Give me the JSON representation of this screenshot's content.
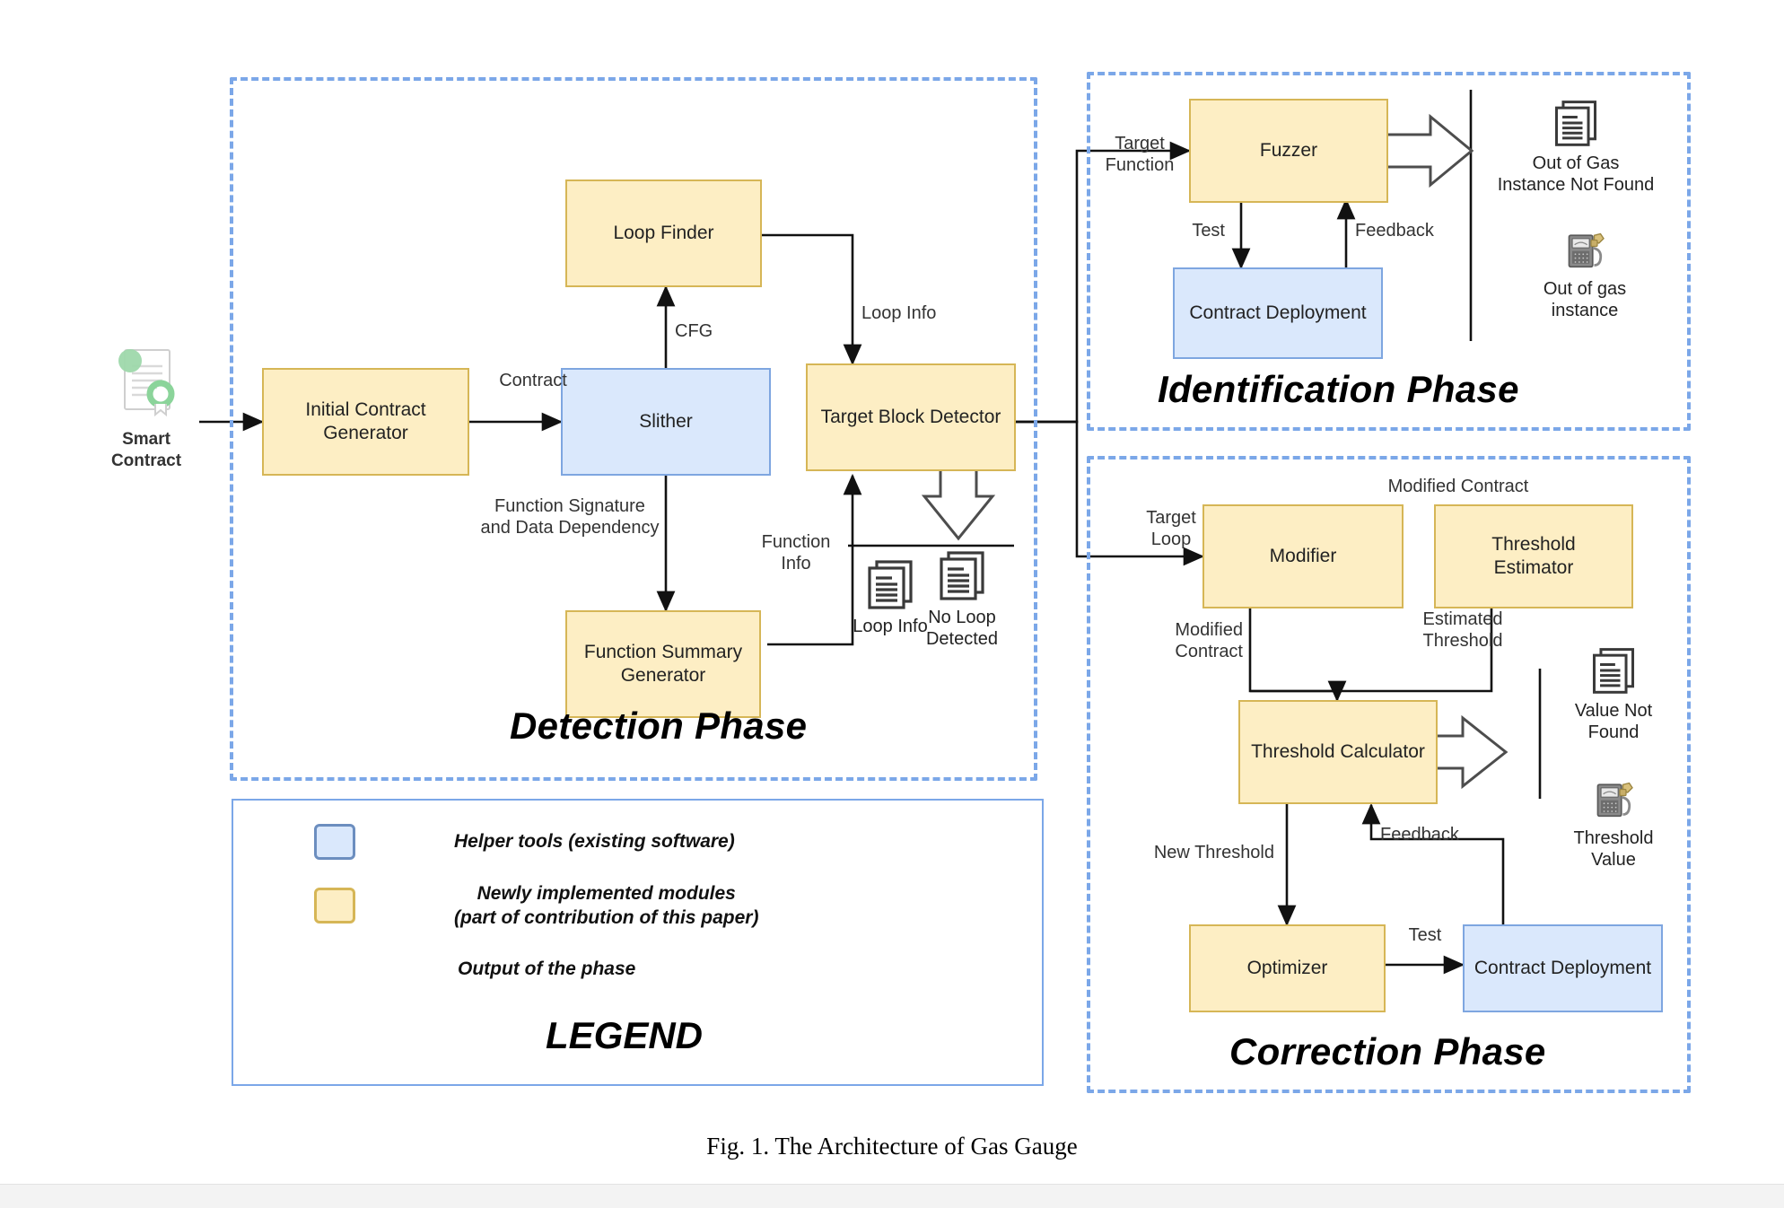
{
  "figure": {
    "caption": "Fig. 1.  The Architecture of Gas Gauge"
  },
  "colors": {
    "module_fill": "#fdeec4",
    "module_stroke": "#d6b656",
    "helper_fill": "#dae8fc",
    "helper_stroke": "#7ea6e0",
    "phase_border": "#7ba7e8",
    "seal": "#8bd49a"
  },
  "input": {
    "label": "Smart\nContract",
    "icon": "contract-document-icon"
  },
  "phases": [
    {
      "id": "detection",
      "title": "Detection Phase"
    },
    {
      "id": "identification",
      "title": "Identification Phase"
    },
    {
      "id": "correction",
      "title": "Correction Phase"
    }
  ],
  "detection": {
    "title": "Detection Phase",
    "nodes": [
      {
        "id": "initial-contract-generator",
        "label": "Initial Contract\nGenerator",
        "kind": "module"
      },
      {
        "id": "slither",
        "label": "Slither",
        "kind": "helper"
      },
      {
        "id": "loop-finder",
        "label": "Loop Finder",
        "kind": "module"
      },
      {
        "id": "target-block-detector",
        "label": "Target Block Detector",
        "kind": "module"
      },
      {
        "id": "function-summary-generator",
        "label": "Function Summary\nGenerator",
        "kind": "module"
      }
    ],
    "edge_labels": [
      {
        "id": "contract",
        "text": "Contract"
      },
      {
        "id": "cfg",
        "text": "CFG"
      },
      {
        "id": "loop-info",
        "text": "Loop Info"
      },
      {
        "id": "function-signature",
        "text": "Function Signature\nand Data Dependency"
      },
      {
        "id": "function-info",
        "text": "Function\nInfo"
      }
    ],
    "outputs": [
      {
        "id": "loop-info-output",
        "label": "Loop Info",
        "icon": "documents-icon"
      },
      {
        "id": "no-loop-detected-output",
        "label": "No Loop\nDetected",
        "icon": "documents-icon"
      }
    ]
  },
  "identification": {
    "title": "Identification Phase",
    "nodes": [
      {
        "id": "fuzzer",
        "label": "Fuzzer",
        "kind": "module"
      },
      {
        "id": "contract-deployment",
        "label": "Contract Deployment",
        "kind": "helper"
      }
    ],
    "edge_labels": [
      {
        "id": "target-function",
        "text": "Target\nFunction"
      },
      {
        "id": "test",
        "text": "Test"
      },
      {
        "id": "feedback",
        "text": "Feedback"
      }
    ],
    "outputs": [
      {
        "id": "out-of-gas-not-found",
        "label": "Out of Gas\nInstance Not Found",
        "icon": "documents-icon"
      },
      {
        "id": "out-of-gas-instance",
        "label": "Out of gas\ninstance",
        "icon": "gas-pump-icon"
      }
    ]
  },
  "correction": {
    "title": "Correction Phase",
    "nodes": [
      {
        "id": "modifier",
        "label": "Modifier",
        "kind": "module"
      },
      {
        "id": "threshold-estimator",
        "label": "Threshold\nEstimator",
        "kind": "module"
      },
      {
        "id": "threshold-calculator",
        "label": "Threshold Calculator",
        "kind": "module"
      },
      {
        "id": "optimizer",
        "label": "Optimizer",
        "kind": "module"
      },
      {
        "id": "contract-deployment",
        "label": "Contract Deployment",
        "kind": "helper"
      }
    ],
    "edge_labels": [
      {
        "id": "target-loop",
        "text": "Target\nLoop"
      },
      {
        "id": "modified-contract-top",
        "text": "Modified Contract"
      },
      {
        "id": "modified-contract-down",
        "text": "Modified\nContract"
      },
      {
        "id": "estimated-threshold",
        "text": "Estimated\nThreshold"
      },
      {
        "id": "new-threshold",
        "text": "New Threshold"
      },
      {
        "id": "test",
        "text": "Test"
      },
      {
        "id": "feedback",
        "text": "Feedback"
      }
    ],
    "outputs": [
      {
        "id": "value-not-found",
        "label": "Value Not\nFound",
        "icon": "documents-icon"
      },
      {
        "id": "threshold-value",
        "label": "Threshold\nValue",
        "icon": "gas-pump-icon"
      }
    ]
  },
  "legend": {
    "title": "LEGEND",
    "items": [
      {
        "id": "helper-tools",
        "swatch": "blue",
        "text": "Helper tools (existing software)"
      },
      {
        "id": "new-modules",
        "swatch": "yellow",
        "text": "Newly implemented modules\n(part of contribution of this paper)"
      },
      {
        "id": "phase-output",
        "swatch": "arrow",
        "text": "Output of the phase"
      }
    ]
  }
}
